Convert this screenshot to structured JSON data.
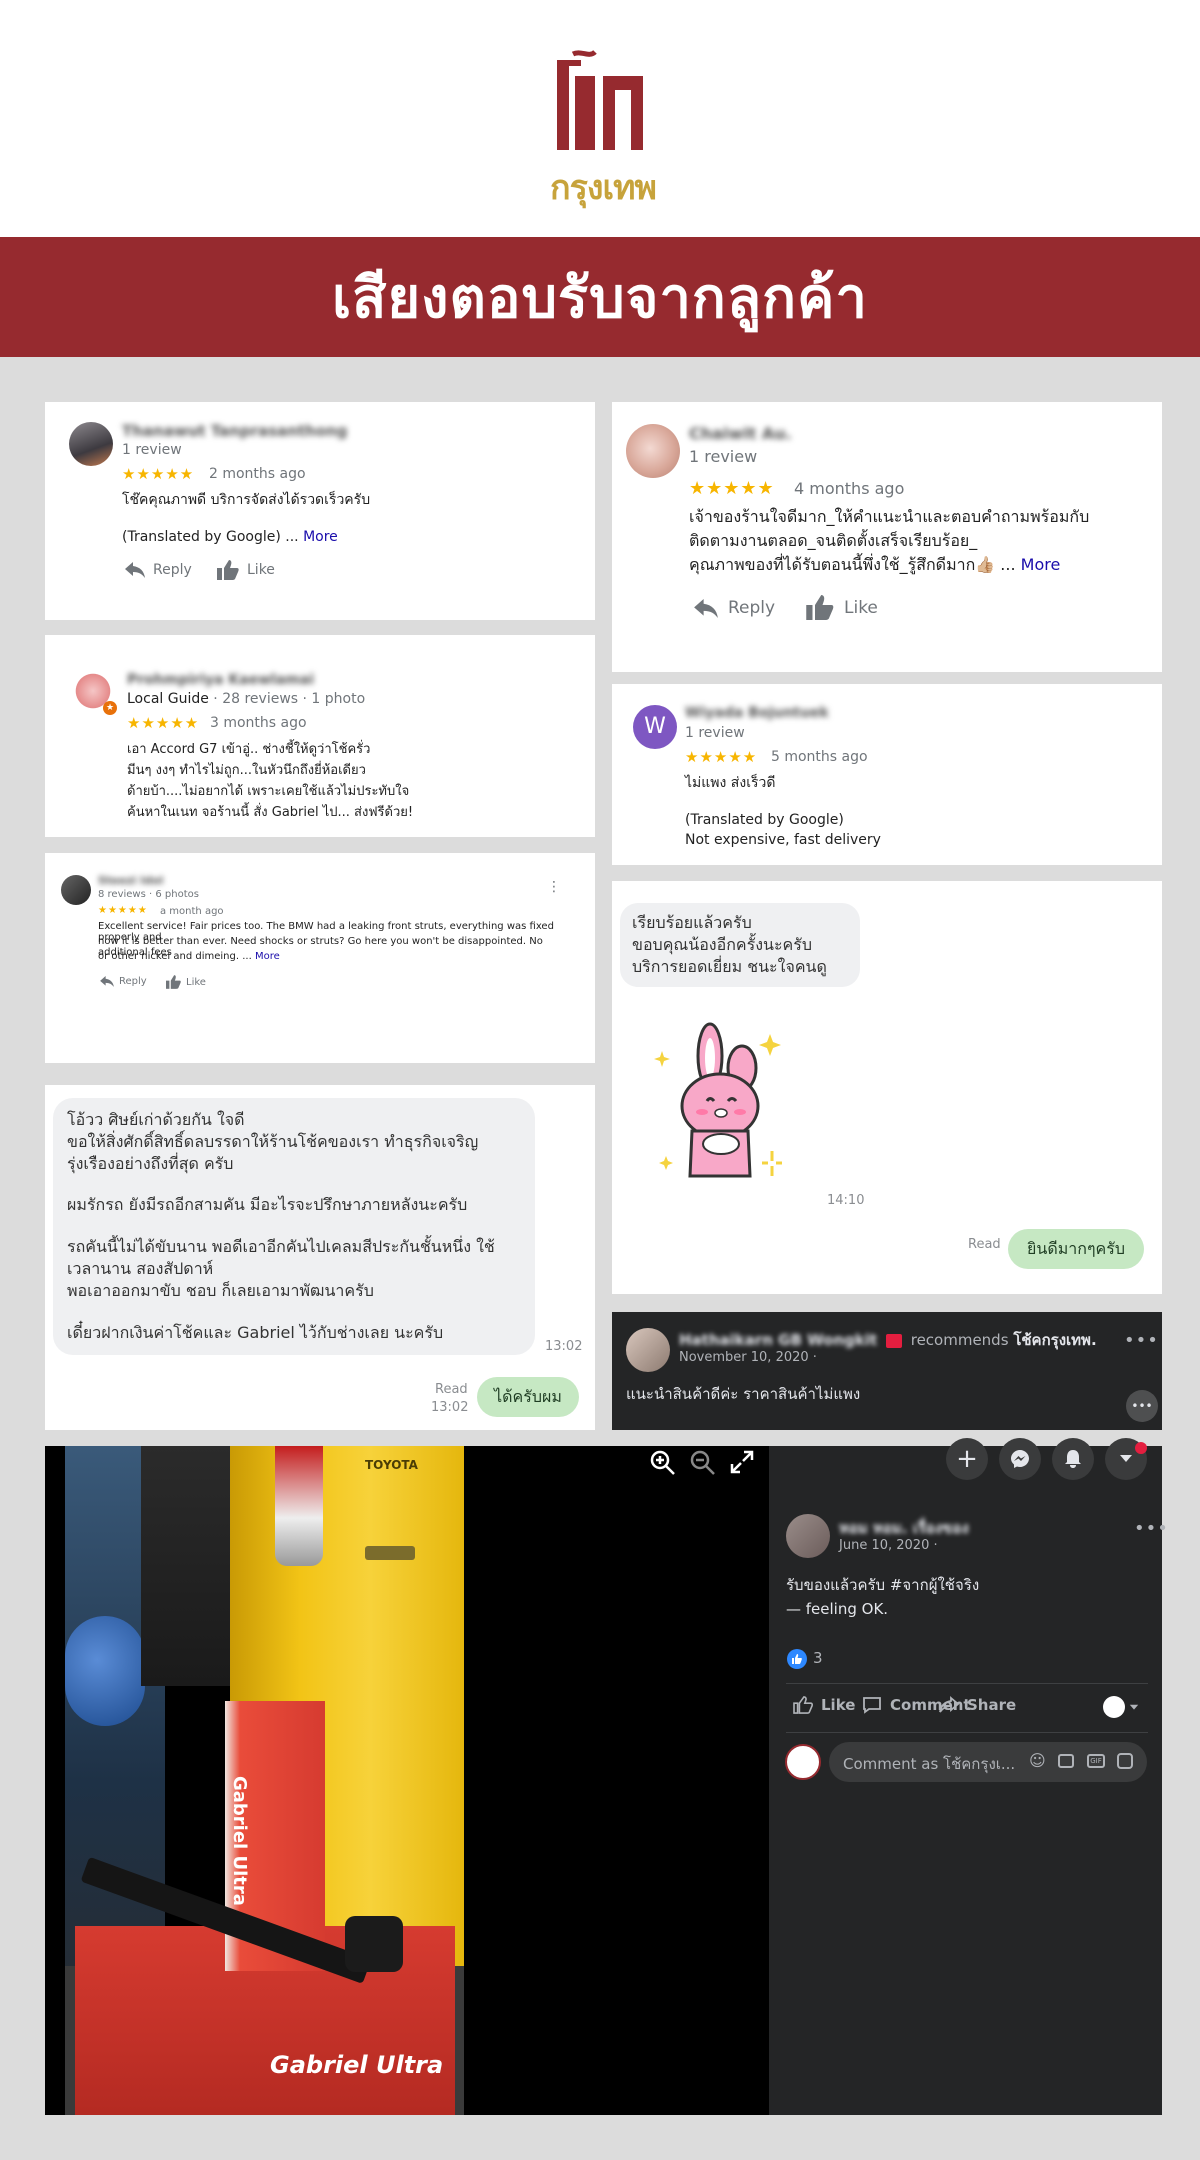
{
  "header": {
    "logo_top": "โช๊ค",
    "logo_bottom": "กรุงเทพ",
    "banner_title": "เสียงตอบรับจากลูกค้า"
  },
  "colors": {
    "brand_red": "#962a2f",
    "logo_gold": "#c7a33b",
    "star_gold": "#f7b500",
    "link_blue": "#1a0dab",
    "fb_dark": "#242526",
    "bubble_green": "#c6e8c3"
  },
  "reviews": {
    "r1": {
      "name": "Thanawut Tanprasanthong",
      "count": "1 review",
      "stars": "★★★★★",
      "time": "2 months ago",
      "text": "โช๊คคุณภาพดี บริการจัดส่งได้รวดเร็วครับ",
      "translated": "(Translated by Google) ...",
      "more": "More",
      "reply": "Reply",
      "like": "Like"
    },
    "r2": {
      "name": "Chaiwit Au.",
      "count": "1 review",
      "stars": "★★★★★",
      "time": "4 months ago",
      "line1": "เจ้าของร้านใจดีมาก_ให้คำแนะนำและตอบคำถามพร้อมกับ",
      "line2": "ติดตามงานตลอด_จนติดตั้งเสร็จเรียบร้อย_",
      "line3": "คุณภาพของที่ได้รับตอนนี้พึ่งใช้_รู้สึกดีมาก👍🏼 ...",
      "more": "More",
      "reply": "Reply",
      "like": "Like"
    },
    "r3": {
      "name": "Prohmpiriya Kaewlamai",
      "guide": "Local Guide",
      "meta": " · 28 reviews · 1 photo",
      "stars": "★★★★★",
      "time": "3 months ago",
      "line1": "เอา Accord G7 เข้าอู่.. ช่างชี้ให้ดูว่าโช้ครั่ว",
      "line2": "มีนๆ งงๆ ทำไรไม่ถูก...ในหัวนึกถึงยี่ห้อเดียว",
      "line3": "ด้ายบ้า....ไม่อยากได้ เพราะเคยใช้แล้วไม่ประทับใจ",
      "line4": "ค้นหาในเนท จอร้านนี้ สั่ง Gabriel ไป... ส่งฟรีด้วย!"
    },
    "r4": {
      "initial": "W",
      "name": "Wiyada Bojuntuek",
      "count": "1 review",
      "stars": "★★★★★",
      "time": "5 months ago",
      "text": "ไม่แพง ส่งเร็วดี",
      "translated": "(Translated by Google)",
      "translation": "Not expensive, fast delivery"
    },
    "r5": {
      "name": "Steezi Idol",
      "meta": "8 reviews · 6 photos",
      "stars": "★★★★★",
      "time": "a month ago",
      "line1": "Excellent service! Fair prices too. The BMW had a leaking front struts, everything was fixed properly and",
      "line2": "now it is better than ever. Need shocks or struts? Go here you won't be disappointed. No additional fees",
      "line3": "or other nickel and dimeing. ...",
      "more": "More",
      "reply": "Reply",
      "like": "Like"
    }
  },
  "chat1": {
    "line1": "เรียบร้อยแล้วครับ",
    "line2": "ขอบคุณน้องอีกครั้งนะครับ",
    "line3": "บริการยอดเยี่ยม ชนะใจคนดู",
    "time": "14:10",
    "read": "Read",
    "reply": "ยินดีมากๆครับ"
  },
  "chat2": {
    "line1": "โอ้วว ศิษย์เก่าด้วยกัน ใจดี",
    "line2": "ขอให้สิ่งศักดิ์สิทธิ์ดลบรรดาให้ร้านโช้คของเรา ทำธุรกิจเจริญ",
    "line3": "รุ่งเรืองอย่างถึงที่สุด ครับ",
    "line4": "ผมรักรถ ยังมีรถอีกสามคัน มีอะไรจะปรึกษาภายหลังนะครับ",
    "line5": "รถคันนี้ไม่ได้ขับนาน พอดีเอาอีกคันไปเคลมสีประกันชั้นหนึ่ง ใช้",
    "line6": "เวลานาน สองสัปดาห์",
    "line7": "พอเอาออกมาขับ ชอบ ก็เลยเอามาพัฒนาครับ",
    "line8": "เดี๋ยวฝากเงินค่าโช้คและ Gabriel ไว้กับช่างเลย นะครับ",
    "time": "13:02",
    "read": "Read",
    "read_time": "13:02",
    "reply": "ได้ครับผม"
  },
  "fb_recommend": {
    "name": "Hathaikarn GB Wongkit",
    "recommends": "recommends",
    "page": "โช้คกรุงเทพ.",
    "date": "November 10, 2020 ·",
    "text": "แนะนำสินค้าดีค่ะ ราคาสินค้าไม่แพง"
  },
  "fb_post": {
    "name": "หอม หอม. เรื่องของ",
    "date": "June 10, 2020 ·",
    "text": "รับของแล้วครับ #จากผู้ใช้จริง",
    "feeling": "— feeling OK.",
    "likes": "3",
    "like": "Like",
    "comment": "Comment",
    "share": "Share",
    "comment_placeholder": "Comment as โช้คกรุงเ..."
  },
  "photo": {
    "car_badge": "TOYOTA",
    "box_brand": "Gabriel Ultra",
    "box_brand_side": "Gabriel Ultra"
  },
  "icons": [
    "reply-icon",
    "thumbs-up-icon",
    "zoom-in-icon",
    "zoom-out-icon",
    "fullscreen-icon",
    "plus-icon",
    "messenger-icon",
    "bell-icon",
    "caret-down-icon",
    "more-icon",
    "globe-icon",
    "comment-icon",
    "share-icon",
    "emoji-icon",
    "camera-icon",
    "gif-icon",
    "sticker-icon"
  ]
}
